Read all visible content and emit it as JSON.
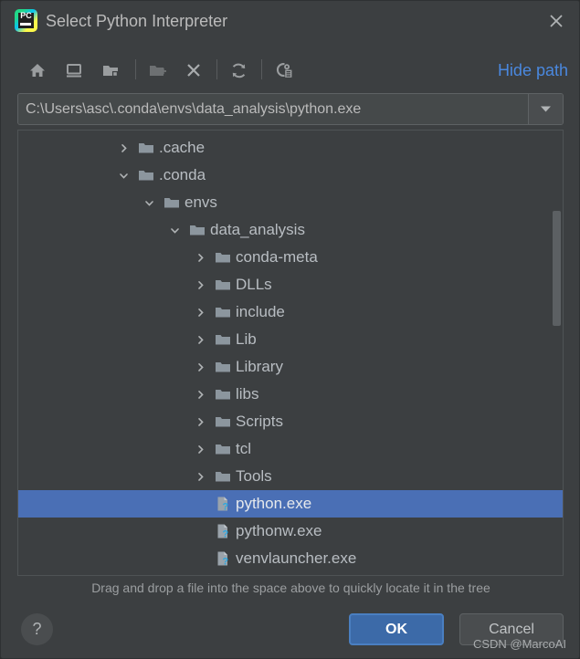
{
  "window": {
    "title": "Select Python Interpreter",
    "logo_text": "PC",
    "close_icon": "close-icon"
  },
  "toolbar": {
    "icons": [
      {
        "name": "home-icon",
        "title": "Home"
      },
      {
        "name": "desktop-icon",
        "title": "Desktop"
      },
      {
        "name": "project-folder-icon",
        "title": "Project Directory"
      },
      {
        "name": "new-folder-icon",
        "title": "New Folder"
      },
      {
        "name": "delete-icon",
        "title": "Delete"
      },
      {
        "name": "refresh-icon",
        "title": "Refresh"
      },
      {
        "name": "show-hidden-files-icon",
        "title": "Show Hidden Files"
      }
    ],
    "hide_path_label": "Hide path"
  },
  "path_field": {
    "value": "C:\\Users\\asc\\.conda\\envs\\data_analysis\\python.exe",
    "placeholder": "",
    "dropdown_icon": "chevron-down-icon"
  },
  "tree": {
    "rows": [
      {
        "label": ".cache",
        "depth": 3,
        "type": "folder",
        "arrow": "collapsed",
        "selected": false
      },
      {
        "label": ".conda",
        "depth": 3,
        "type": "folder",
        "arrow": "expanded",
        "selected": false
      },
      {
        "label": "envs",
        "depth": 4,
        "type": "folder",
        "arrow": "expanded",
        "selected": false
      },
      {
        "label": "data_analysis",
        "depth": 5,
        "type": "folder",
        "arrow": "expanded",
        "selected": false
      },
      {
        "label": "conda-meta",
        "depth": 6,
        "type": "folder",
        "arrow": "collapsed",
        "selected": false
      },
      {
        "label": "DLLs",
        "depth": 6,
        "type": "folder",
        "arrow": "collapsed",
        "selected": false
      },
      {
        "label": "include",
        "depth": 6,
        "type": "folder",
        "arrow": "collapsed",
        "selected": false
      },
      {
        "label": "Lib",
        "depth": 6,
        "type": "folder",
        "arrow": "collapsed",
        "selected": false
      },
      {
        "label": "Library",
        "depth": 6,
        "type": "folder",
        "arrow": "collapsed",
        "selected": false
      },
      {
        "label": "libs",
        "depth": 6,
        "type": "folder",
        "arrow": "collapsed",
        "selected": false
      },
      {
        "label": "Scripts",
        "depth": 6,
        "type": "folder",
        "arrow": "collapsed",
        "selected": false
      },
      {
        "label": "tcl",
        "depth": 6,
        "type": "folder",
        "arrow": "collapsed",
        "selected": false
      },
      {
        "label": "Tools",
        "depth": 6,
        "type": "folder",
        "arrow": "collapsed",
        "selected": false
      },
      {
        "label": "python.exe",
        "depth": 6,
        "type": "file",
        "arrow": "none",
        "selected": true
      },
      {
        "label": "pythonw.exe",
        "depth": 6,
        "type": "file",
        "arrow": "none",
        "selected": false
      },
      {
        "label": "venvlauncher.exe",
        "depth": 6,
        "type": "file",
        "arrow": "none",
        "selected": false
      },
      {
        "label": "",
        "depth": 6,
        "type": "file",
        "arrow": "none",
        "selected": false
      }
    ],
    "selected_label": "python.exe",
    "annotation_color": "#ff0000",
    "selection_color": "#4a6fb5"
  },
  "hint": {
    "text": "Drag and drop a file into the space above to quickly locate it in the tree"
  },
  "footer": {
    "help_label": "?",
    "ok_label": "OK",
    "cancel_label": "Cancel"
  },
  "watermark": {
    "text": "CSDN @MarcoAI"
  },
  "colors": {
    "accent": "#4a88df",
    "ok_button": "#3c6aa8",
    "selection": "#4a6fb5",
    "annotation": "#ff0000",
    "background": "#3c3f41"
  }
}
